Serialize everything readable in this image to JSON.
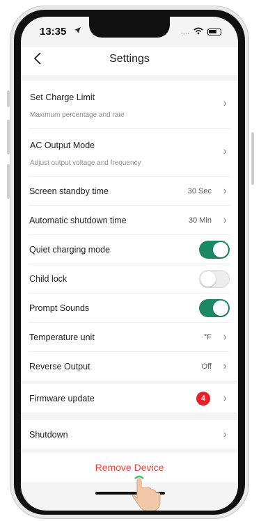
{
  "status_bar": {
    "time": "13:35",
    "signal": "....",
    "location_icon": "location-arrow-icon"
  },
  "header": {
    "title": "Settings",
    "back_icon": "chevron-left-icon"
  },
  "settings": {
    "charge_limit": {
      "label": "Set Charge Limit",
      "subtitle": "Maximum percentage and rate"
    },
    "ac_output": {
      "label": "AC Output Mode",
      "subtitle": "Adjust output voltage and frequency"
    },
    "screen_standby": {
      "label": "Screen standby time",
      "value": "30 Sec"
    },
    "auto_shutdown": {
      "label": "Automatic shutdown time",
      "value": "30 Min"
    },
    "quiet_charging": {
      "label": "Quiet charging mode",
      "enabled": true
    },
    "child_lock": {
      "label": "Child lock",
      "enabled": false
    },
    "prompt_sounds": {
      "label": "Prompt Sounds",
      "enabled": true
    },
    "temp_unit": {
      "label": "Temperature unit",
      "value": "°F"
    },
    "reverse_output": {
      "label": "Reverse Output",
      "value": "Off"
    }
  },
  "firmware": {
    "label": "Firmware update",
    "badge": "4"
  },
  "shutdown": {
    "label": "Shutdown"
  },
  "remove_device": {
    "label": "Remove Device"
  },
  "colors": {
    "toggle_on": "#1b8a64",
    "badge": "#e8202a",
    "danger_text": "#e8453c"
  }
}
